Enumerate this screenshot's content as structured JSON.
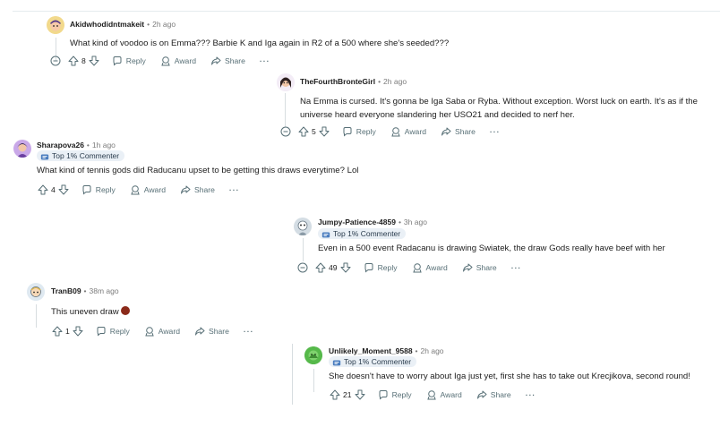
{
  "labels": {
    "reply": "Reply",
    "award": "Award",
    "share": "Share",
    "more": "···"
  },
  "comments": [
    {
      "user": "Akidwhodidntmakeit",
      "time": "2h ago",
      "text": [
        "What kind of voodoo is on Emma??? Barbie K and Iga again in R2 of a 500 where she's seeded???"
      ],
      "votes": "8",
      "badge": ""
    },
    {
      "user": "TheFourthBronteGirl",
      "time": "2h ago",
      "text": [
        "Na Emma is cursed. It's gonna be Iga Saba or Ryba. Without exception. Worst luck on earth. It's as if the",
        "universe heard everyone slandering her USO21 and decided to nerf her."
      ],
      "votes": "5",
      "badge": ""
    },
    {
      "user": "Sharapova26",
      "time": "1h ago",
      "text": [
        "What kind of tennis gods did Raducanu upset to be getting this draws everytime? Lol"
      ],
      "votes": "4",
      "badge": "Top 1% Commenter"
    },
    {
      "user": "Jumpy-Patience-4859",
      "time": "3h ago",
      "text": [
        "Even in a 500 event Radacanu is drawing Swiatek, the draw Gods really have beef with her"
      ],
      "votes": "49",
      "badge": "Top 1% Commenter"
    },
    {
      "user": "TranB09",
      "time": "38m ago",
      "text": [
        "This uneven draw"
      ],
      "votes": "1",
      "badge": ""
    },
    {
      "user": "Unlikely_Moment_9588",
      "time": "2h ago",
      "text": [
        "She doesn't have to worry about Iga just yet, first she has to take out Krecjikova, second round!"
      ],
      "votes": "21",
      "badge": "Top 1% Commenter"
    }
  ],
  "colors": {
    "text": "#1c1c1c",
    "meta": "#7c7c7c",
    "action": "#576f76",
    "badge_bg": "#eaf0f6",
    "thread": "#d7dde0"
  }
}
